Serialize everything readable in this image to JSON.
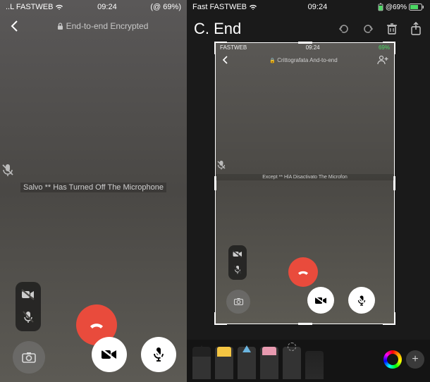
{
  "left": {
    "status": {
      "carrier": "..L FASTWEB",
      "time": "09:24",
      "battery": "69%"
    },
    "header": {
      "encrypted_label": "End-to-end Encrypted"
    },
    "muted_notice": "Salvo ** Has Turned Off The Microphone"
  },
  "right": {
    "status": {
      "carrier": "Fast FASTWEB",
      "time": "09:24",
      "battery_pct": "69%",
      "battery_prefix": "@"
    },
    "title": "C. End",
    "nested": {
      "status": {
        "carrier": "FASTWEB",
        "time": "09:24",
        "battery": "69%"
      },
      "header": {
        "encrypted_label": "Crittografata And-to-end"
      },
      "muted_notice": "Except ** HlA Disactivato The Microfon"
    }
  }
}
